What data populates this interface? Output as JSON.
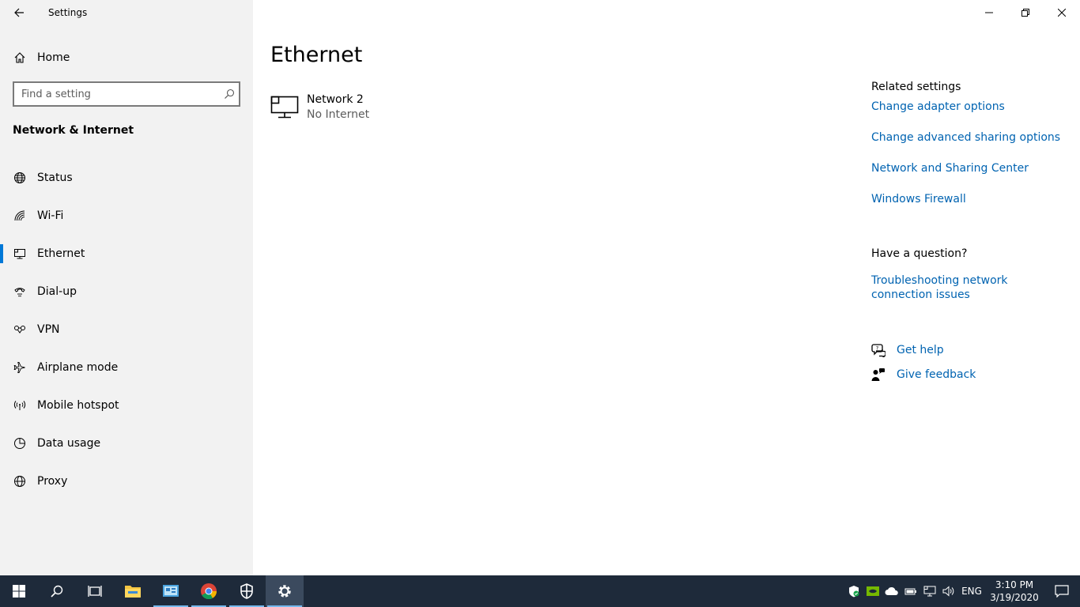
{
  "app": {
    "title": "Settings"
  },
  "sidebar": {
    "home_label": "Home",
    "search_placeholder": "Find a setting",
    "section_title": "Network & Internet",
    "items": [
      {
        "label": "Status",
        "icon": "globe-icon"
      },
      {
        "label": "Wi-Fi",
        "icon": "wifi-icon"
      },
      {
        "label": "Ethernet",
        "icon": "ethernet-icon",
        "selected": true
      },
      {
        "label": "Dial-up",
        "icon": "dialup-icon"
      },
      {
        "label": "VPN",
        "icon": "vpn-icon"
      },
      {
        "label": "Airplane mode",
        "icon": "airplane-icon"
      },
      {
        "label": "Mobile hotspot",
        "icon": "hotspot-icon"
      },
      {
        "label": "Data usage",
        "icon": "data-usage-icon"
      },
      {
        "label": "Proxy",
        "icon": "proxy-icon"
      }
    ]
  },
  "main": {
    "title": "Ethernet",
    "network": {
      "name": "Network 2",
      "status": "No Internet"
    },
    "related": {
      "heading": "Related settings",
      "links": [
        "Change adapter options",
        "Change advanced sharing options",
        "Network and Sharing Center",
        "Windows Firewall"
      ]
    },
    "question": {
      "heading": "Have a question?",
      "link": "Troubleshooting network connection issues"
    },
    "help": {
      "get_help": "Get help",
      "give_feedback": "Give feedback"
    }
  },
  "taskbar": {
    "language": "ENG",
    "time": "3:10 PM",
    "date": "3/19/2020"
  },
  "colors": {
    "accent": "#0078d7",
    "link": "#0063b1",
    "sidebar_bg": "#f2f2f2",
    "taskbar_bg": "#1e2a3a"
  }
}
